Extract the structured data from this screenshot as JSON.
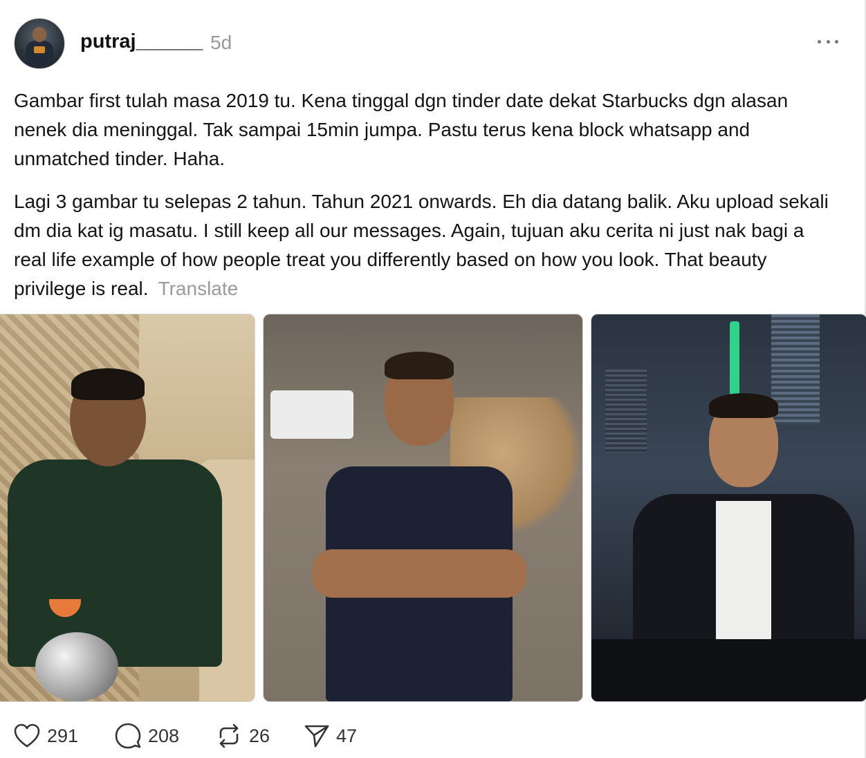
{
  "post": {
    "username": "putraj______",
    "time": "5d",
    "paragraphs": [
      "Gambar first tulah masa 2019 tu. Kena tinggal dgn tinder date dekat Starbucks dgn alasan nenek dia meninggal. Tak sampai 15min jumpa. Pastu terus kena block whatsapp and unmatched tinder. Haha.",
      "Lagi 3 gambar tu selepas 2 tahun. Tahun 2021 onwards. Eh dia datang balik. Aku upload sekali dm dia kat ig masatu. I still keep all our messages. Again, tujuan aku cerita ni just nak bagi a real life example of how people treat you differently based on how you look. That beauty privilege is real."
    ],
    "translate_label": "Translate"
  },
  "actions": {
    "likes": "291",
    "comments": "208",
    "reposts": "26",
    "shares": "47"
  },
  "icons": {
    "like": "heart-icon",
    "comment": "speech-bubble-icon",
    "repost": "repost-icon",
    "share": "send-icon",
    "more": "more-horizontal-icon"
  },
  "colors": {
    "text": "#141414",
    "muted": "#9a9a9a"
  }
}
